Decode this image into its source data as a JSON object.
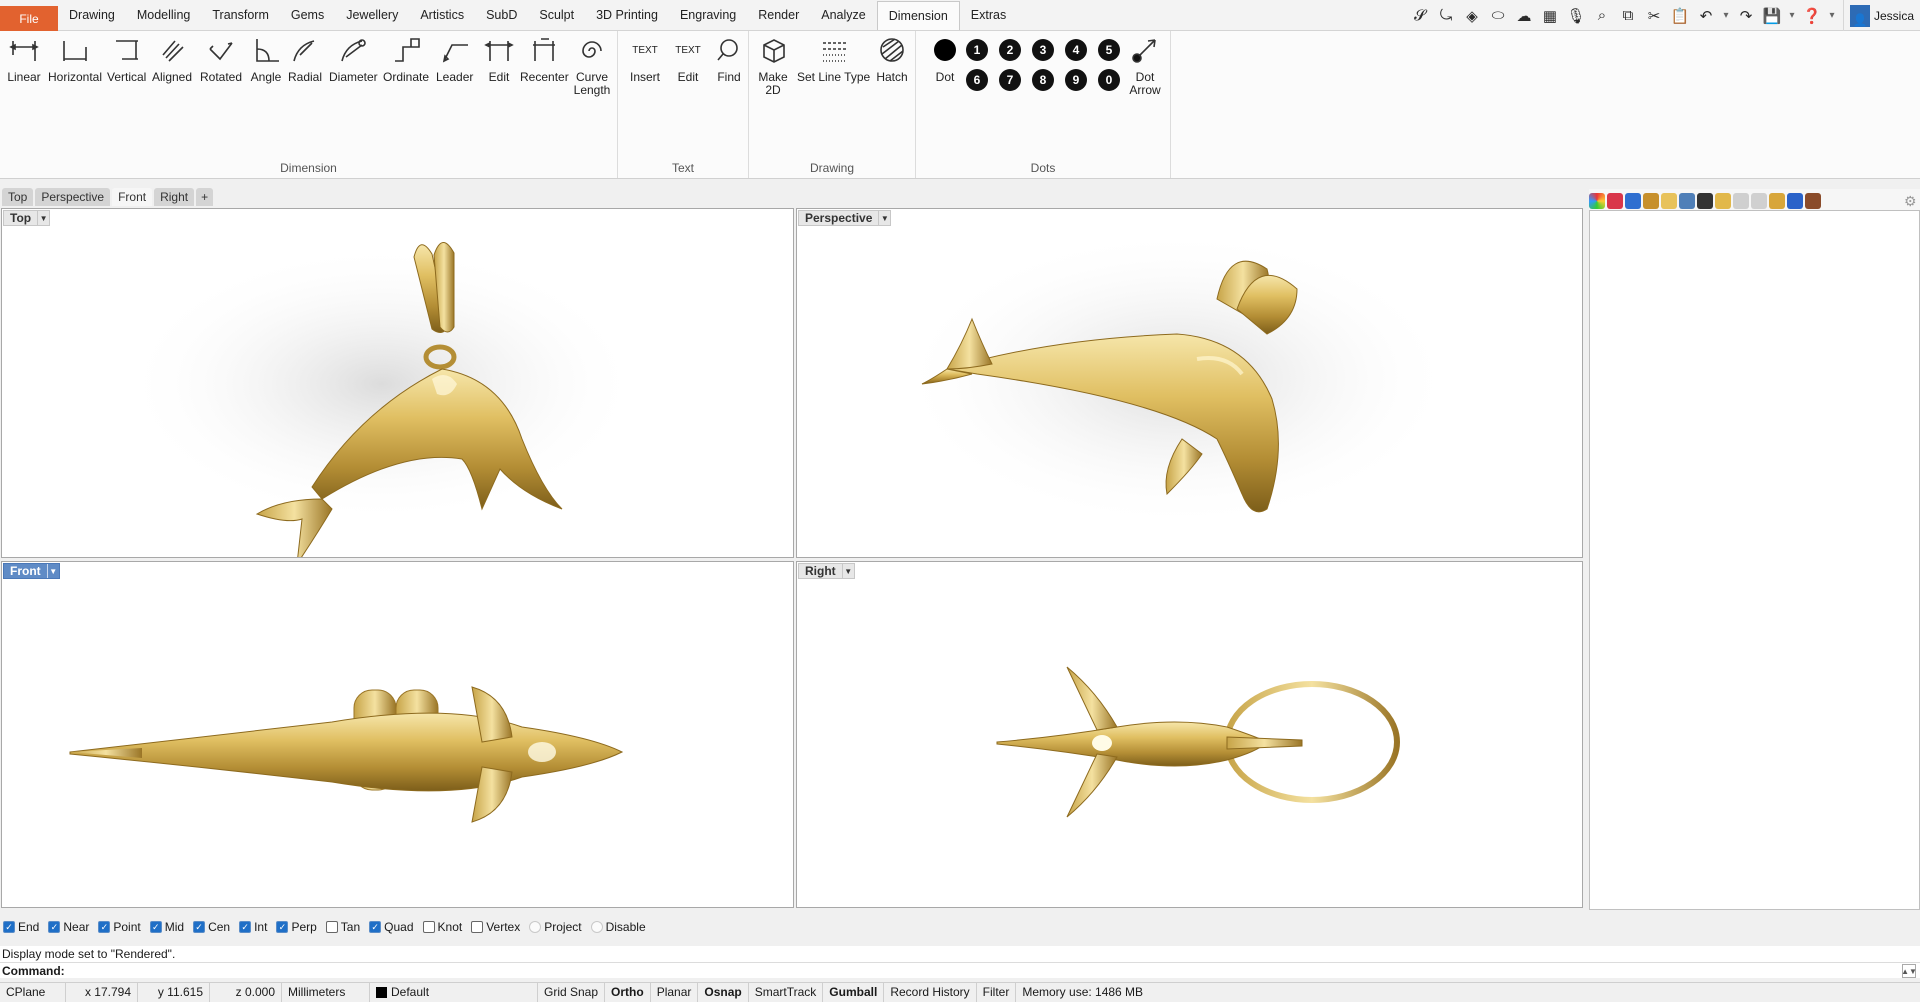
{
  "menubar": {
    "file_label": "File",
    "items": [
      "Drawing",
      "Modelling",
      "Transform",
      "Gems",
      "Jewellery",
      "Artistics",
      "SubD",
      "Sculpt",
      "3D Printing",
      "Engraving",
      "Render",
      "Analyze",
      "Dimension",
      "Extras"
    ],
    "active_item": "Dimension",
    "user_name": "Jessica",
    "quick_icons": [
      "matrix-logo-icon",
      "curve-icon",
      "gem-icon",
      "shape-icon",
      "cloud-icon",
      "clapper-icon",
      "microphone-icon",
      "zoom-selected-icon",
      "copy-icon",
      "cut-icon",
      "paste-icon",
      "undo-icon",
      "redo-icon",
      "save-icon",
      "help-icon"
    ]
  },
  "ribbon": {
    "groups": {
      "dimension": {
        "title": "Dimension",
        "tools": [
          "Linear",
          "Horizontal",
          "Vertical",
          "Aligned",
          "Rotated",
          "Angle",
          "Radial",
          "Diameter",
          "Ordinate",
          "Leader",
          "Edit",
          "Recenter",
          "Curve Length"
        ]
      },
      "text": {
        "title": "Text",
        "tools": [
          "Insert",
          "Edit",
          "Find"
        ],
        "icon_text": "TEXT"
      },
      "drawing": {
        "title": "Drawing",
        "tools": [
          "Make 2D",
          "Set Line Type",
          "Hatch"
        ]
      },
      "dots": {
        "title": "Dots",
        "tools": [
          "Dot",
          "Dot Arrow"
        ],
        "numbers_row1": [
          "1",
          "2",
          "3",
          "4",
          "5"
        ],
        "numbers_row2": [
          "6",
          "7",
          "8",
          "9",
          "0"
        ]
      }
    }
  },
  "viewport_tabs": [
    "Top",
    "Perspective",
    "Front",
    "Right",
    "+"
  ],
  "active_tab": "Front",
  "viewports": {
    "top": "Top",
    "perspective": "Perspective",
    "front": "Front",
    "right": "Right"
  },
  "osnap": [
    {
      "label": "End",
      "state": "on"
    },
    {
      "label": "Near",
      "state": "on"
    },
    {
      "label": "Point",
      "state": "on"
    },
    {
      "label": "Mid",
      "state": "on"
    },
    {
      "label": "Cen",
      "state": "on"
    },
    {
      "label": "Int",
      "state": "on"
    },
    {
      "label": "Perp",
      "state": "on"
    },
    {
      "label": "Tan",
      "state": "off"
    },
    {
      "label": "Quad",
      "state": "on"
    },
    {
      "label": "Knot",
      "state": "off"
    },
    {
      "label": "Vertex",
      "state": "off"
    },
    {
      "label": "Project",
      "state": "radio"
    },
    {
      "label": "Disable",
      "state": "radio"
    }
  ],
  "command": {
    "history": "Display mode set to \"Rendered\".",
    "prompt": "Command:"
  },
  "status": {
    "cplane": "CPlane",
    "x": "x 17.794",
    "y": "y 11.615",
    "z": "z 0.000",
    "units": "Millimeters",
    "layer": "Default",
    "grid_snap": "Grid Snap",
    "ortho": "Ortho",
    "planar": "Planar",
    "osnap": "Osnap",
    "smarttrack": "SmartTrack",
    "gumball": "Gumball",
    "record_history": "Record History",
    "filter": "Filter",
    "memory": "Memory use: 1486 MB"
  },
  "colors": {
    "file_button": "#e2622f",
    "accent": "#1f6fc7",
    "gold_light": "#f3e0a0",
    "gold_mid": "#d4b15a",
    "gold_dark": "#8d6a1e"
  }
}
